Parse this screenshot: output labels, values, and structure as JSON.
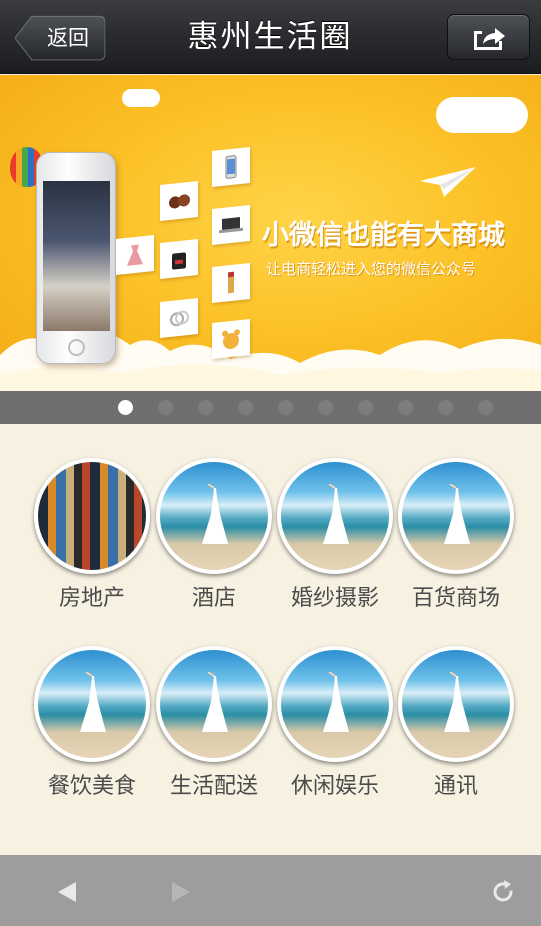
{
  "navbar": {
    "back_label": "返回",
    "title": "惠州生活圈",
    "share_icon": "share-icon"
  },
  "banner": {
    "headline": "小微信也能有大商城",
    "subline": "让电商轻松进入您的微信公众号",
    "colors": {
      "background": "#fcc228",
      "text": "#ffffff"
    },
    "pager": {
      "count": 10,
      "active_index": 0
    }
  },
  "categories": [
    {
      "label": "房地产"
    },
    {
      "label": "酒店"
    },
    {
      "label": "婚纱摄影"
    },
    {
      "label": "百货商场"
    },
    {
      "label": "餐饮美食"
    },
    {
      "label": "生活配送"
    },
    {
      "label": "休闲娱乐"
    },
    {
      "label": "通讯"
    }
  ],
  "toolbar": {
    "back_icon": "triangle-left-icon",
    "forward_icon": "triangle-right-icon",
    "refresh_icon": "refresh-icon"
  }
}
